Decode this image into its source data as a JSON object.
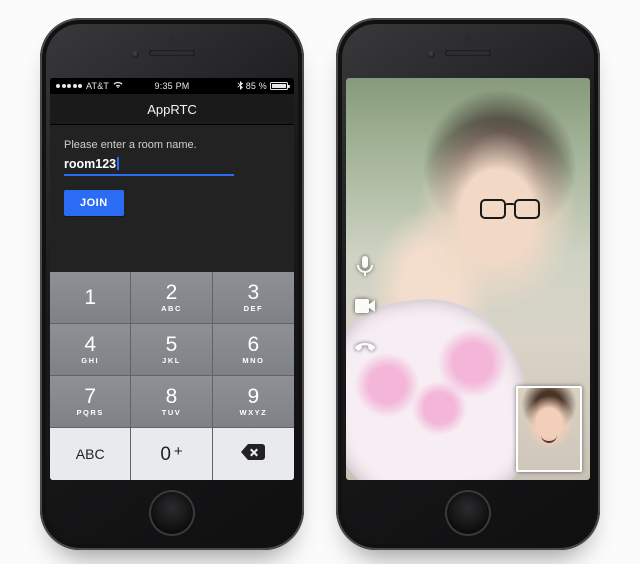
{
  "statusbar": {
    "carrier": "AT&T",
    "time": "9:35 PM",
    "bt_icon": "bluetooth-icon",
    "battery_pct": "85 %",
    "battery_fill_pct": 85,
    "signal_filled": 5
  },
  "app": {
    "title": "AppRTC",
    "prompt": "Please enter a room name.",
    "room_value": "room123",
    "join_label": "JOIN"
  },
  "keypad": {
    "keys": [
      {
        "digit": "1",
        "letters": ""
      },
      {
        "digit": "2",
        "letters": "ABC"
      },
      {
        "digit": "3",
        "letters": "DEF"
      },
      {
        "digit": "4",
        "letters": "GHI"
      },
      {
        "digit": "5",
        "letters": "JKL"
      },
      {
        "digit": "6",
        "letters": "MNO"
      },
      {
        "digit": "7",
        "letters": "PQRS"
      },
      {
        "digit": "8",
        "letters": "TUV"
      },
      {
        "digit": "9",
        "letters": "WXYZ"
      }
    ],
    "abc_label": "ABC",
    "zero_digit": "0",
    "zero_plus": "+"
  },
  "call": {
    "mic_icon": "microphone-icon",
    "cam_icon": "camera-icon",
    "hangup_icon": "hangup-icon"
  }
}
